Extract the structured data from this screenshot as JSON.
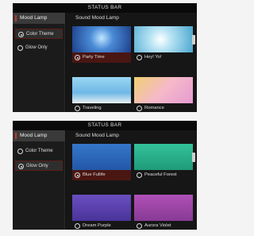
{
  "screens": [
    {
      "status_bar": "STATUS BAR",
      "sidebar": {
        "title": "Mood Lamp",
        "options": [
          {
            "label": "Color Theme",
            "selected": true
          },
          {
            "label": "Glow Only",
            "selected": false
          }
        ]
      },
      "content": {
        "title": "Sound Mood Lamp",
        "tiles": [
          {
            "label": "Party Time",
            "selected": true,
            "color": "#3a76c6"
          },
          {
            "label": "Hey! Yo!",
            "selected": false,
            "color": "#9ad0e6"
          },
          {
            "label": "Traveling",
            "selected": false,
            "color": "#7ec3ea"
          },
          {
            "label": "Romance",
            "selected": false,
            "color": "#f2b8d2"
          }
        ]
      }
    },
    {
      "status_bar": "STATUS BAR",
      "sidebar": {
        "title": "Mood Lamp",
        "options": [
          {
            "label": "Color Theme",
            "selected": false
          },
          {
            "label": "Glow Only",
            "selected": true
          }
        ]
      },
      "content": {
        "title": "Sound Mood Lamp",
        "tiles": [
          {
            "label": "Blue Fullife",
            "selected": true,
            "color": "#2760b4"
          },
          {
            "label": "Peaceful Forest",
            "selected": false,
            "color": "#27b08c"
          },
          {
            "label": "Dream Purple",
            "selected": false,
            "color": "#5a3eb0"
          },
          {
            "label": "Aurora Violet",
            "selected": false,
            "color": "#9a44a6"
          }
        ]
      }
    }
  ],
  "colors": {
    "accent": "#c0392b",
    "selected_caption": "#4a1612",
    "background": "#111111"
  }
}
